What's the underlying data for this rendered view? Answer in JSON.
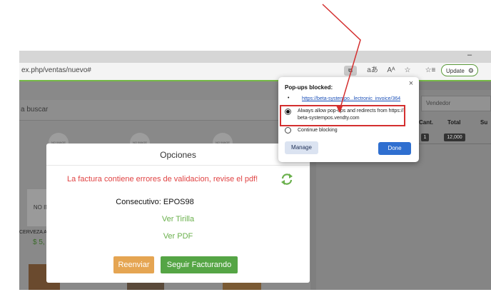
{
  "browser": {
    "url": "ex.php/ventas/nuevo#",
    "minimize_glyph": "–",
    "toolbar_icons": [
      "aあ",
      "Aᴬ",
      "☆",
      "☆≡"
    ],
    "update_label": "Update"
  },
  "page": {
    "search_placeholder": "a buscar",
    "no_image_label": "NO IMAGE",
    "product": {
      "noimg_label": "NO IM",
      "name": "CERVEZA A",
      "price": "$ 5,"
    },
    "vendedor_placeholder": "Vendedor",
    "table": {
      "headers": [
        "Cant.",
        "Total",
        "Su"
      ],
      "row": {
        "cant": "1",
        "total": "12,000"
      }
    }
  },
  "modal": {
    "title": "Opciones",
    "error_message": "La factura contiene errores de validacion, revise el pdf!",
    "consecutivo": "Consecutivo: EPOS98",
    "ver_tirilla": "Ver Tirilla",
    "ver_pdf": "Ver PDF",
    "reenviar_label": "Reenviar",
    "seguir_label": "Seguir Facturando"
  },
  "popup_blocked": {
    "title": "Pop-ups blocked:",
    "bullet": "•",
    "link": "https://beta-systempo...lectronic_invoice/364",
    "option_allow_line1": "Always allow pop-ups and redirects from https://",
    "option_allow_line2": "beta-systempos.vendty.com",
    "option_block": "Continue blocking",
    "selected": "allow",
    "manage_label": "Manage",
    "done_label": "Done",
    "close_glyph": "×"
  },
  "colors": {
    "accent_green": "#6ab04c",
    "error_red": "#e04343",
    "reenviar_orange": "#e5a552",
    "seguir_green": "#55a545",
    "done_blue": "#2f6fd0",
    "annotation_red": "#d42f2f"
  },
  "icons": {
    "refresh": "refresh-icon",
    "close": "close-icon",
    "popup_blocked": "popup-blocked-icon"
  }
}
